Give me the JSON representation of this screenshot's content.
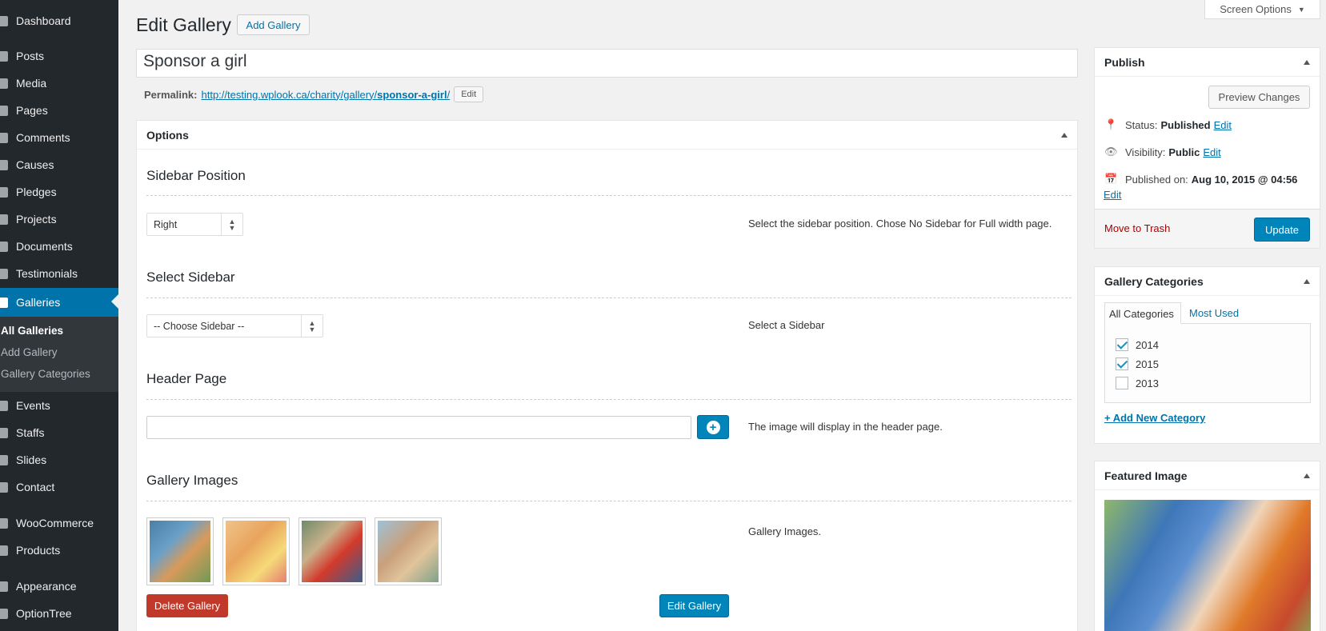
{
  "sidebar": {
    "items": [
      {
        "label": "Dashboard",
        "icon": "dashboard-icon"
      },
      {
        "label": "Posts",
        "icon": "pin-icon"
      },
      {
        "label": "Media",
        "icon": "media-icon"
      },
      {
        "label": "Pages",
        "icon": "pages-icon"
      },
      {
        "label": "Comments",
        "icon": "comments-icon"
      },
      {
        "label": "Causes",
        "icon": "causes-icon"
      },
      {
        "label": "Pledges",
        "icon": "pledges-icon"
      },
      {
        "label": "Projects",
        "icon": "folder-icon"
      },
      {
        "label": "Documents",
        "icon": "documents-icon"
      },
      {
        "label": "Testimonials",
        "icon": "testimonials-icon"
      },
      {
        "label": "Galleries",
        "icon": "gallery-icon"
      },
      {
        "label": "Events",
        "icon": "calendar-icon"
      },
      {
        "label": "Staffs",
        "icon": "staff-icon"
      },
      {
        "label": "Slides",
        "icon": "slides-icon"
      },
      {
        "label": "Contact",
        "icon": "mail-icon"
      },
      {
        "label": "WooCommerce",
        "icon": "woocommerce-icon"
      },
      {
        "label": "Products",
        "icon": "products-icon"
      },
      {
        "label": "Appearance",
        "icon": "appearance-icon"
      },
      {
        "label": "OptionTree",
        "icon": "optiontree-icon"
      }
    ],
    "submenu": [
      "All Galleries",
      "Add Gallery",
      "Gallery Categories"
    ]
  },
  "header": {
    "title": "Edit Gallery",
    "add_button": "Add Gallery",
    "screen_options": "Screen Options"
  },
  "post": {
    "title": "Sponsor a girl",
    "permalink_label": "Permalink:",
    "permalink_base": "http://testing.wplook.ca/charity/gallery/",
    "permalink_slug": "sponsor-a-girl",
    "permalink_trail": "/",
    "permalink_edit": "Edit"
  },
  "options": {
    "heading": "Options",
    "sidebar_position": {
      "label": "Sidebar Position",
      "value": "Right",
      "description": "Select the sidebar position. Chose No Sidebar for Full width page."
    },
    "select_sidebar": {
      "label": "Select Sidebar",
      "value": "-- Choose Sidebar --",
      "description": "Select a Sidebar"
    },
    "header_page": {
      "label": "Header Page",
      "value": "",
      "description": "The image will display in the header page."
    },
    "gallery_images": {
      "label": "Gallery Images",
      "description": "Gallery Images.",
      "delete_button": "Delete Gallery",
      "edit_button": "Edit Gallery"
    }
  },
  "publish": {
    "heading": "Publish",
    "preview_button": "Preview Changes",
    "status_label": "Status:",
    "status_value": "Published",
    "visibility_label": "Visibility:",
    "visibility_value": "Public",
    "published_label": "Published on:",
    "published_value": "Aug 10, 2015 @ 04:56",
    "edit_link": "Edit",
    "trash_link": "Move to Trash",
    "update_button": "Update"
  },
  "categories": {
    "heading": "Gallery Categories",
    "tab_all": "All Categories",
    "tab_most": "Most Used",
    "items": [
      {
        "label": "2014",
        "checked": true
      },
      {
        "label": "2015",
        "checked": true
      },
      {
        "label": "2013",
        "checked": false
      }
    ],
    "add_link": "+ Add New Category"
  },
  "featured": {
    "heading": "Featured Image"
  },
  "colors": {
    "accent": "#0073aa",
    "primary_button": "#0085ba",
    "sidebar": "#23282d",
    "danger": "#c0392b"
  }
}
